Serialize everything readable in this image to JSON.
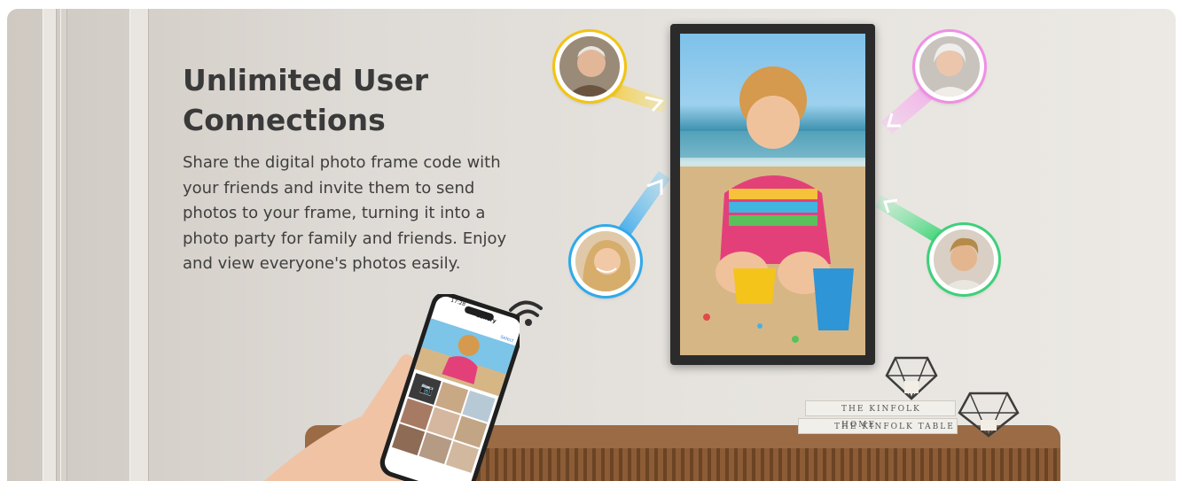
{
  "headline": {
    "line1": "Unlimited User",
    "line2": "Connections"
  },
  "description": {
    "line1": "Share the digital photo frame code with",
    "line2": "your friends and invite them to send",
    "line3": "photos to your frame, turning it into a",
    "line4": "photo party for family and friends. Enjoy",
    "line5": "and view everyone's photos easily."
  },
  "phone": {
    "time": "17:28",
    "title": "Gallery",
    "action": "Select"
  },
  "books": {
    "book1": "THE KINFOLK HOME",
    "book2": "THE KINFOLK TABLE"
  },
  "colors": {
    "arrow_yellow": "#f6c11a",
    "arrow_pink": "#f29be8",
    "arrow_blue": "#2ea4ea",
    "arrow_green": "#37d271",
    "text": "#3a3a3a"
  },
  "icons": [
    "camera-icon",
    "wifi-icon",
    "arrow-icon"
  ]
}
